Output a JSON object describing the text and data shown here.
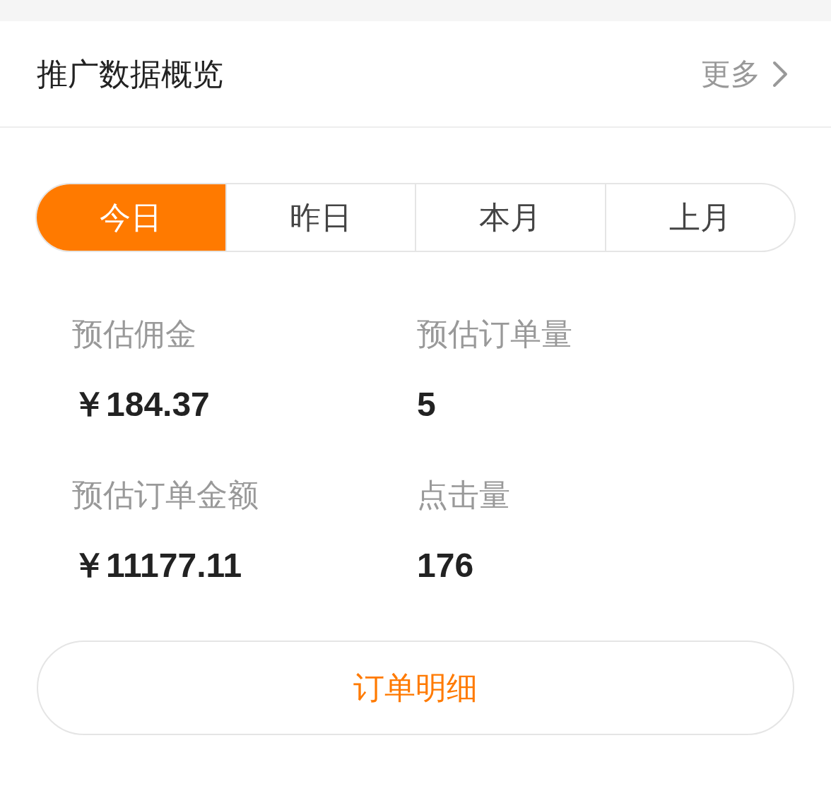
{
  "header": {
    "title": "推广数据概览",
    "more": "更多"
  },
  "tabs": [
    {
      "label": "今日",
      "selected": true
    },
    {
      "label": "昨日",
      "selected": false
    },
    {
      "label": "本月",
      "selected": false
    },
    {
      "label": "上月",
      "selected": false
    }
  ],
  "stats": [
    {
      "label": "预估佣金",
      "value": "￥184.37"
    },
    {
      "label": "预估订单量",
      "value": "5"
    },
    {
      "label": "预估订单金额",
      "value": "￥11177.11"
    },
    {
      "label": "点击量",
      "value": "176"
    }
  ],
  "button": "订单明细"
}
